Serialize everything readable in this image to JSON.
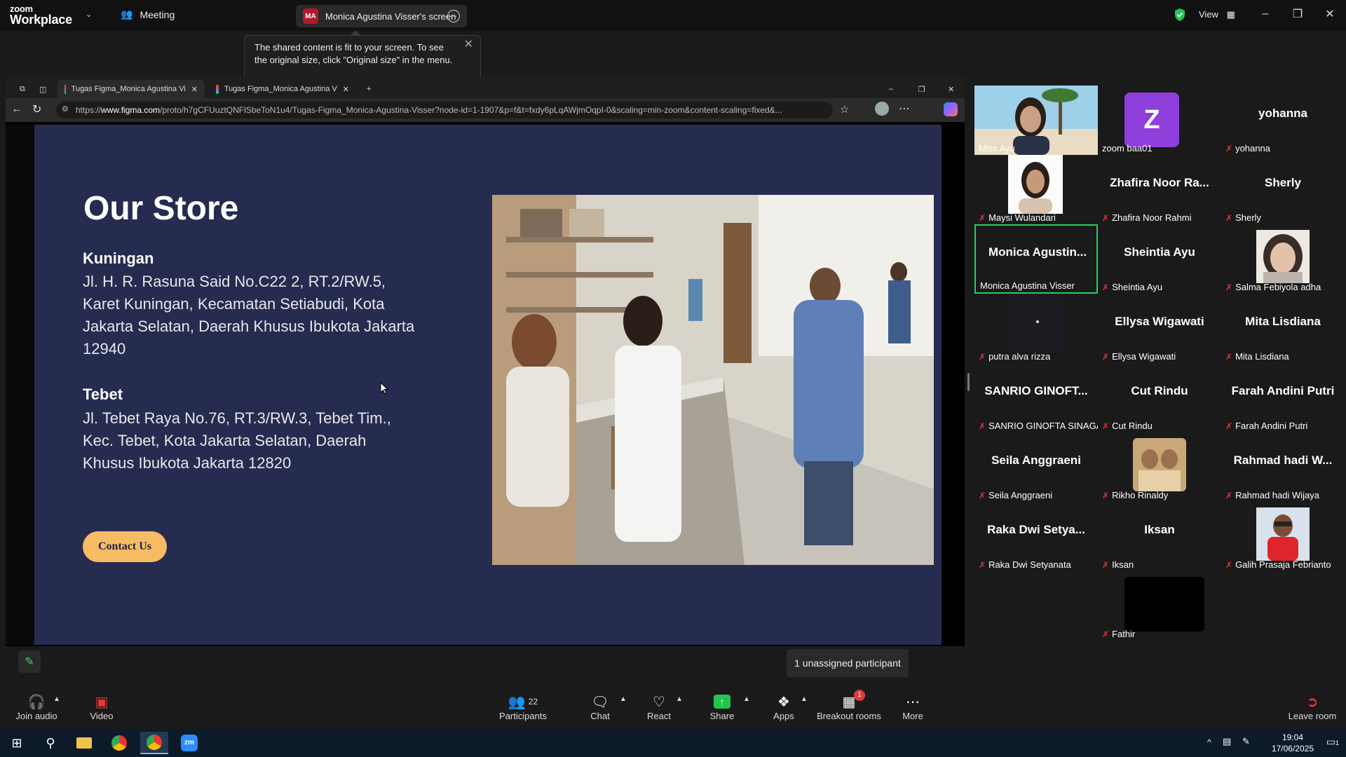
{
  "zoom": {
    "logo_line1": "zoom",
    "logo_line2": "Workplace",
    "meeting_label": "Meeting",
    "share_initials": "MA",
    "share_title": "Monica Agustina Visser's screen",
    "view_label": "View"
  },
  "tooltip": {
    "text": "The shared content is fit to your screen. To see the original size, click \"Original size\" in the menu."
  },
  "browser": {
    "tabs": [
      {
        "label": "Tugas Figma_Monica Agustina Vi"
      },
      {
        "label": "Tugas Figma_Monica Agustina V"
      }
    ],
    "url_prefix": "https://",
    "url_host": "www.figma.com",
    "url_path": "/proto/h7gCFUuztQNFlSbeToN1u4/Tugas-Figma_Monica-Agustina-Visser?node-id=1-1907&p=f&t=fxdy6pLqAWjmOqpI-0&scaling=min-zoom&content-scaling=fixed&..."
  },
  "store": {
    "title": "Our Store",
    "locations": [
      {
        "name": "Kuningan",
        "address": " Jl. H. R. Rasuna Said No.C22 2, RT.2/RW.5, Karet Kuningan, Kecamatan Setiabudi, Kota Jakarta Selatan, Daerah Khusus Ibukota Jakarta 12940"
      },
      {
        "name": "Tebet",
        "address": "Jl. Tebet Raya No.76, RT.3/RW.3, Tebet Tim., Kec. Tebet, Kota Jakarta Selatan, Daerah Khusus Ibukota Jakarta 12820"
      }
    ],
    "contact_label": "Contact Us"
  },
  "participants": [
    {
      "label": "Miss Ayu",
      "name": "",
      "video": "photo"
    },
    {
      "label": "zoom baa01",
      "name": "",
      "avatar": "Z"
    },
    {
      "label": "yohanna",
      "name": "yohanna"
    },
    {
      "label": "Maysi Wulandari",
      "name": "",
      "video": "photo"
    },
    {
      "label": "Zhafira Noor Rahmi",
      "name": "Zhafira Noor Ra..."
    },
    {
      "label": "Sherly",
      "name": "Sherly"
    },
    {
      "label": "Monica Agustina Visser",
      "name": "Monica  Agustin...",
      "active": true
    },
    {
      "label": "Sheintia Ayu",
      "name": "Sheintia Ayu"
    },
    {
      "label": "Salma Febiyola adha",
      "name": "",
      "video": "photo"
    },
    {
      "label": "putra alva rizza",
      "name": "",
      "video": "dark"
    },
    {
      "label": "Ellysa Wigawati",
      "name": "Ellysa Wigawati"
    },
    {
      "label": "Mita Lisdiana",
      "name": "Mita Lisdiana"
    },
    {
      "label": "SANRIO GINOFTA SINAGA",
      "name": "SANRIO GINOFT..."
    },
    {
      "label": "Cut Rindu",
      "name": "Cut Rindu"
    },
    {
      "label": "Farah Andini Putri",
      "name": "Farah Andini Putri"
    },
    {
      "label": "Seila Anggraeni",
      "name": "Seila Anggraeni"
    },
    {
      "label": "Rikho Rinaldy",
      "name": "",
      "video": "photo"
    },
    {
      "label": "Rahmad hadi Wijaya",
      "name": "Rahmad hadi W..."
    },
    {
      "label": "Raka Dwi Setyanata",
      "name": "Raka Dwi Setya..."
    },
    {
      "label": "Iksan",
      "name": "Iksan"
    },
    {
      "label": "Galih Prasaja Febrianto",
      "name": "",
      "video": "photo"
    },
    {
      "label": "Fathir",
      "name": "",
      "video": "black"
    }
  ],
  "unassigned": "1 unassigned participant",
  "toolbar": {
    "join_audio": "Join audio",
    "video": "Video",
    "participants": "Participants",
    "participants_count": "22",
    "chat": "Chat",
    "react": "React",
    "share": "Share",
    "apps": "Apps",
    "breakout": "Breakout rooms",
    "breakout_badge": "1",
    "more": "More",
    "leave": "Leave room"
  },
  "taskbar": {
    "time": "19:04",
    "date": "17/06/2025",
    "notif_count": "1"
  },
  "colors": {
    "proto_bg": "#262b50",
    "button_bg": "#f6bb64",
    "active_border": "#23d160",
    "mic_muted": "#e0393e"
  }
}
